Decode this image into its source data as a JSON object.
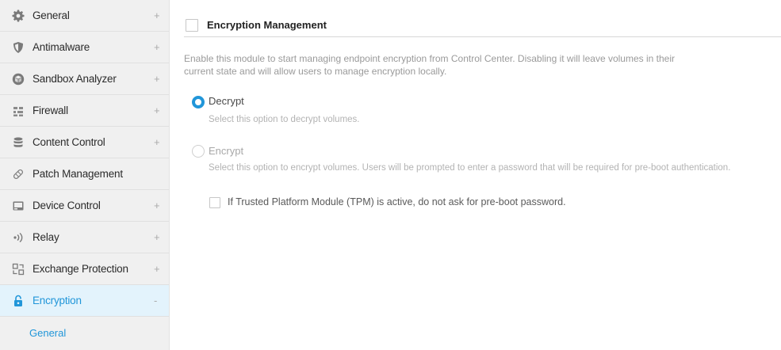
{
  "sidebar": {
    "items": [
      {
        "label": "General",
        "toggle": "+",
        "icon": "gear-icon"
      },
      {
        "label": "Antimalware",
        "toggle": "+",
        "icon": "shield-icon"
      },
      {
        "label": "Sandbox Analyzer",
        "toggle": "+",
        "icon": "cube-icon"
      },
      {
        "label": "Firewall",
        "toggle": "+",
        "icon": "firewall-icon"
      },
      {
        "label": "Content Control",
        "toggle": "+",
        "icon": "database-icon"
      },
      {
        "label": "Patch Management",
        "toggle": "",
        "icon": "bandage-icon"
      },
      {
        "label": "Device Control",
        "toggle": "+",
        "icon": "device-icon"
      },
      {
        "label": "Relay",
        "toggle": "+",
        "icon": "relay-icon"
      },
      {
        "label": "Exchange Protection",
        "toggle": "+",
        "icon": "exchange-icon"
      },
      {
        "label": "Encryption",
        "toggle": "-",
        "icon": "lock-icon"
      }
    ],
    "subitems": [
      {
        "label": "General"
      }
    ]
  },
  "main": {
    "section_title": "Encryption Management",
    "description": "Enable this module to start managing endpoint encryption from Control Center. Disabling it will leave volumes in their current state and will allow users to manage encryption locally.",
    "options": [
      {
        "label": "Decrypt",
        "description": "Select this option to decrypt volumes.",
        "selected": true
      },
      {
        "label": "Encrypt",
        "description": "Select this option to encrypt volumes. Users will be prompted to enter a password that will be required for pre-boot authentication.",
        "selected": false
      }
    ],
    "tpm_checkbox_label": "If Trusted Platform Module (TPM) is active, do not ask for pre-boot password."
  },
  "colors": {
    "accent": "#2196d9",
    "sidebar_bg": "#f0f0f0",
    "active_bg": "#e3f3fc"
  }
}
